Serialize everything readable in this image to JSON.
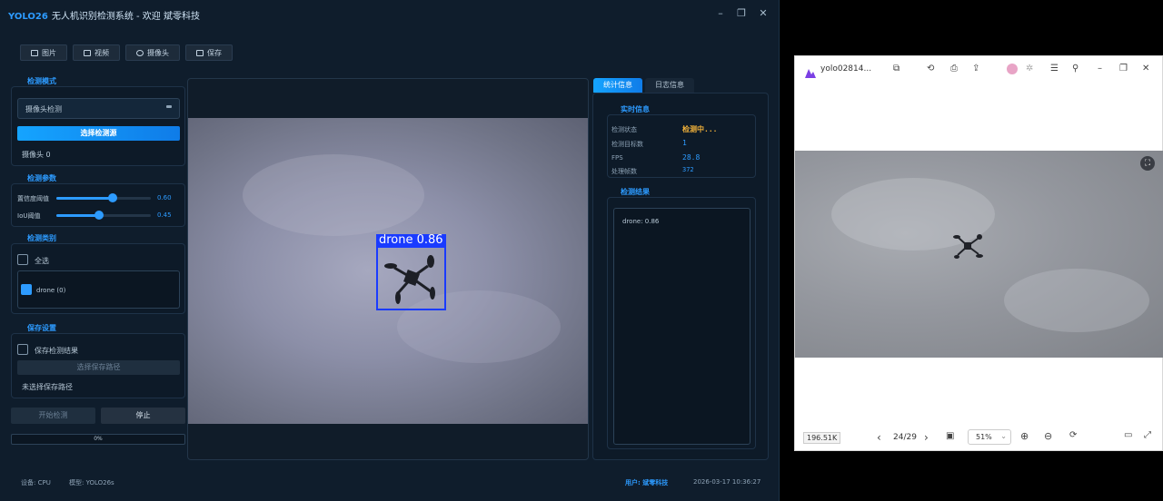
{
  "app": {
    "brand": "YOLO26",
    "title": "无人机识别检测系统 - 欢迎 斌零科技",
    "window_controls": [
      "minimize-icon",
      "maximize-icon",
      "close-icon"
    ],
    "toolbar": [
      {
        "label": "图片",
        "icon": "image-icon"
      },
      {
        "label": "视频",
        "icon": "video-icon"
      },
      {
        "label": "摄像头",
        "icon": "camera-icon"
      },
      {
        "label": "保存",
        "icon": "save-icon"
      }
    ],
    "mode_section": {
      "title": "检测模式",
      "selected": "摄像头检测",
      "select_button": "选择检测源",
      "source_label": "摄像头 0"
    },
    "params_section": {
      "title": "检测参数",
      "confidence": {
        "label": "置信度阈值",
        "value": "0.60",
        "level": 0.6
      },
      "iou": {
        "label": "IoU阈值",
        "value": "0.45",
        "level": 0.45
      }
    },
    "class_section": {
      "title": "检测类别",
      "select_all": "全选",
      "items": [
        {
          "label": "drone (0)",
          "checked": true
        }
      ]
    },
    "save_section": {
      "title": "保存设置",
      "save_results": "保存检测结果",
      "choose_path": "选择保存路径",
      "no_path": "未选择保存路径"
    },
    "actions": {
      "start": "开始检测",
      "stop": "停止",
      "progress": "0%"
    },
    "detection": {
      "label": "drone 0.86"
    },
    "tabs": [
      {
        "label": "统计信息",
        "active": true
      },
      {
        "label": "日志信息",
        "active": false
      }
    ],
    "realtime": {
      "title": "实时信息",
      "rows": [
        {
          "key": "检测状态",
          "value": "检测中..."
        },
        {
          "key": "检测目标数",
          "value": "1"
        },
        {
          "key": "FPS",
          "value": "28.8"
        },
        {
          "key": "处理帧数",
          "value": "372"
        }
      ]
    },
    "results": {
      "title": "检测结果",
      "items": [
        "drone: 0.86"
      ]
    },
    "status_bar": {
      "device": "设备: CPU",
      "model": "模型: YOLO26s",
      "user": "用户: 斌零科技",
      "time": "2026-03-17 10:36:27"
    }
  },
  "viewer": {
    "title": "yolo02814...",
    "size": "196.51K",
    "page": "24/29",
    "zoom": "51%"
  },
  "colors": {
    "accent": "#2d9bff",
    "bbox": "#1a3bff",
    "bg": "#0f1d2c"
  }
}
